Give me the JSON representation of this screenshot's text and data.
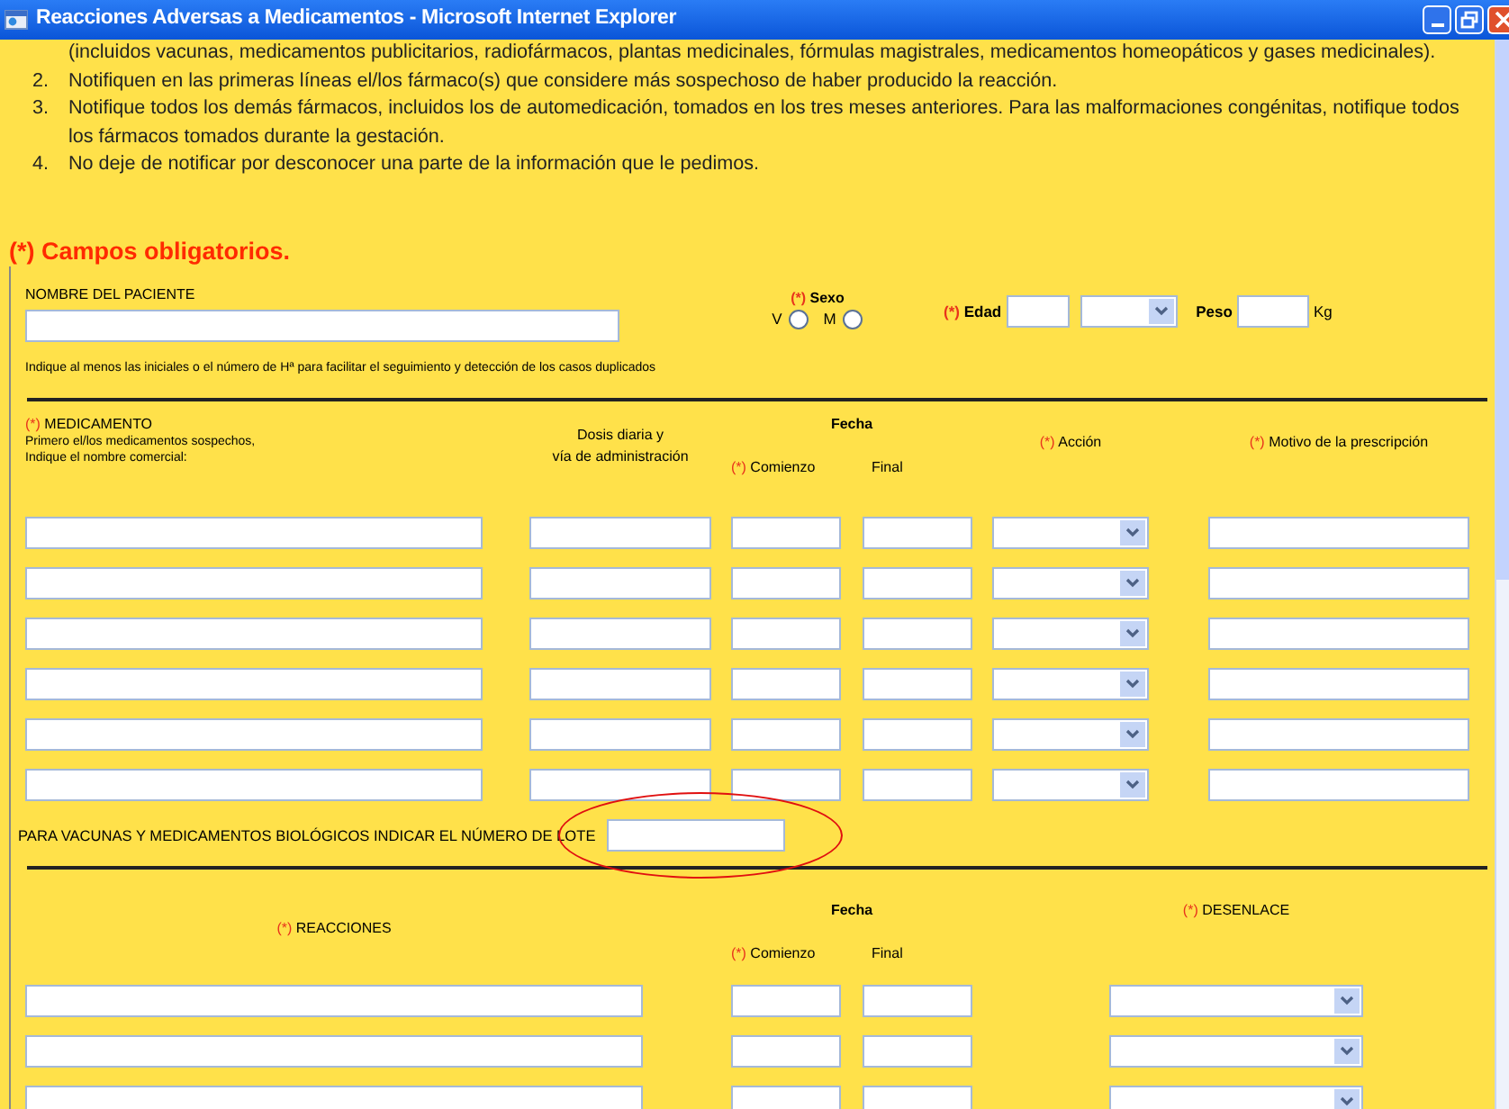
{
  "window": {
    "title": "Reacciones Adversas a Medicamentos - Microsoft Internet Explorer"
  },
  "instructions": [
    {
      "text": "(incluidos vacunas, medicamentos publicitarios, radiofármacos, plantas medicinales, fórmulas magistrales, medicamentos homeopáticos y gases medicinales)."
    },
    {
      "number": "2.",
      "text": "Notifiquen en las primeras líneas el/los fármaco(s) que considere más sospechoso de haber producido la reacción."
    },
    {
      "number": "3.",
      "text": "Notifique todos los demás fármacos, incluidos los de automedicación, tomados en los tres meses anteriores. Para las malformaciones congénitas, notifique todos los fármacos tomados durante la gestación."
    },
    {
      "number": "4.",
      "text": "No deje de notificar por desconocer una parte de la información que le pedimos."
    }
  ],
  "required_note": "(*) Campos obligatorios.",
  "patient": {
    "name_label": "NOMBRE DEL PACIENTE",
    "sex": {
      "marker": "(*)",
      "label": "Sexo",
      "options": [
        {
          "label": "V",
          "selected": false
        },
        {
          "label": "M",
          "selected": false
        }
      ]
    },
    "age": {
      "marker": "(*)",
      "label": "Edad"
    },
    "weight": {
      "label": "Peso",
      "unit": "Kg"
    },
    "hint": "Indique al menos las iniciales o el número de Hª para facilitar el seguimiento y detección de los casos duplicados"
  },
  "medications": {
    "drug": {
      "marker": "(*)",
      "label": "MEDICAMENTO",
      "note_lines": [
        "Primero el/los medicamentos sospechos,",
        "Indique el nombre comercial:"
      ]
    },
    "dose_lines": [
      "Dosis diaria y",
      "vía de administración"
    ],
    "date": {
      "label": "Fecha",
      "start": {
        "marker": "(*)",
        "label": "Comienzo"
      },
      "end": "Final"
    },
    "action": {
      "marker": "(*)",
      "label": "Acción"
    },
    "reason": {
      "marker": "(*)",
      "label": "Motivo de la prescripción"
    },
    "rows": [
      {
        "kind": "entry"
      },
      {
        "kind": "entry"
      },
      {
        "kind": "entry"
      },
      {
        "kind": "entry"
      },
      {
        "kind": "entry"
      },
      {
        "kind": "entry"
      }
    ]
  },
  "lot": {
    "label": "PARA VACUNAS Y MEDICAMENTOS BIOLÓGICOS INDICAR EL NÚMERO DE LOTE",
    "highlighted": true
  },
  "reactions": {
    "reaction": {
      "marker": "(*)",
      "label": "REACCIONES"
    },
    "date": {
      "label": "Fecha",
      "start": {
        "marker": "(*)",
        "label": "Comienzo"
      },
      "end": "Final"
    },
    "outcome": {
      "marker": "(*)",
      "label": "DESENLACE"
    },
    "rows": [
      {
        "kind": "entry"
      },
      {
        "kind": "entry"
      },
      {
        "kind": "entry"
      }
    ]
  }
}
